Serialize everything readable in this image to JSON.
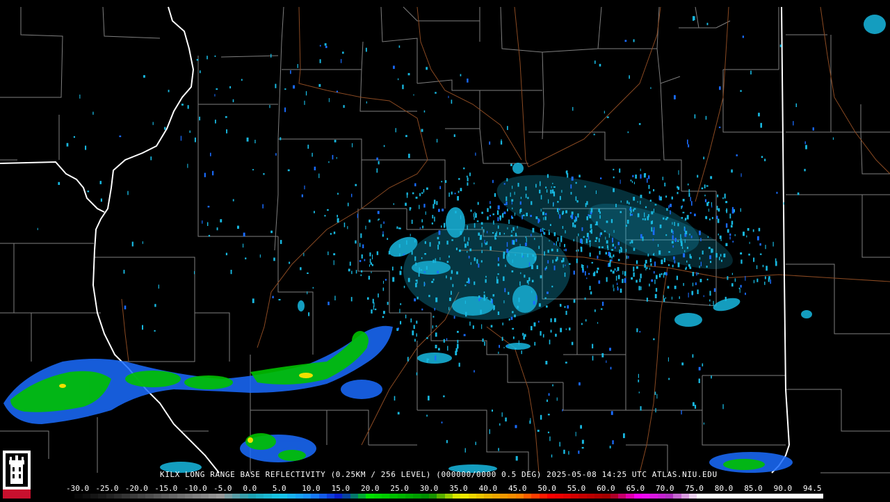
{
  "product_caption": "KILX LONG RANGE BASE REFLECTIVITY (0.25KM / 256 LEVEL) (000000/0000 0.5 DEG) 2025-05-08 14:25 UTC  ATLAS.NIU.EDU",
  "logo": {
    "text": "NIU",
    "colors": {
      "red": "#c8102e",
      "white": "#ffffff",
      "black": "#000000"
    }
  },
  "colorbar": {
    "unit_hint": "dBZ",
    "labels": [
      "-30.0",
      "-25.0",
      "-20.0",
      "-15.0",
      "-10.0",
      "-5.0",
      "0.0",
      "5.0",
      "10.0",
      "15.0",
      "20.0",
      "25.0",
      "30.0",
      "35.0",
      "40.0",
      "45.0",
      "50.0",
      "55.0",
      "60.0",
      "65.0",
      "70.0",
      "75.0",
      "80.0",
      "85.0",
      "90.0",
      "94.5"
    ],
    "gradient_stops": [
      "#000000",
      "#1a1a1a",
      "#3a3a3a",
      "#5a5a5a",
      "#7a7a7a",
      "#9a9a9a",
      "#1fa0b0",
      "#18c8e8",
      "#1a8cff",
      "#0a1acb",
      "#00e000",
      "#00b800",
      "#008a00",
      "#f2f200",
      "#e6b000",
      "#ff8000",
      "#ff0000",
      "#cc0000",
      "#a00000",
      "#ff00ff",
      "#b030c0",
      "#ffffff",
      "#ffffff",
      "#ffffff",
      "#ffffff",
      "#ffffff"
    ]
  },
  "colors": {
    "state_border": "#ffffff",
    "county_border": "#8a8a8a",
    "highway": "#8b4a22",
    "echo_light": "#18b8e0",
    "echo_moderate": "#1a6cff",
    "echo_heavy": "#00c000",
    "echo_core": "#f0e000"
  }
}
